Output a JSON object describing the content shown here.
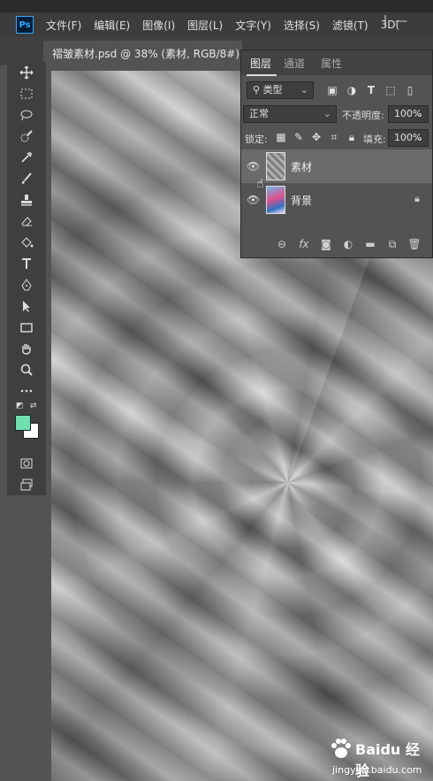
{
  "app": {
    "logo": "Ps"
  },
  "menu": [
    "文件(F)",
    "编辑(E)",
    "图像(I)",
    "图层(L)",
    "文字(Y)",
    "选择(S)",
    "滤镜(T)",
    "3D("
  ],
  "document_tab": {
    "title": "褶皱素材.psd @ 38% (素材, RGB/8#)",
    "close": "×"
  },
  "tools": [
    "move-icon",
    "marquee-icon",
    "lasso-icon",
    "quick-select-icon",
    "eyedropper-icon",
    "brush-icon",
    "stamp-icon",
    "eraser-icon",
    "paint-bucket-icon",
    "type-icon",
    "pen-icon",
    "path-select-icon",
    "rectangle-icon",
    "hand-icon",
    "zoom-icon",
    "more-icon"
  ],
  "colors": {
    "foreground": "#6ee0b0",
    "background": "#ffffff"
  },
  "layers_panel": {
    "tabs": [
      "图层",
      "通道",
      "属性"
    ],
    "filter_kind": "类型",
    "blend_mode": "正常",
    "opacity_label": "不透明度:",
    "opacity_value": "100%",
    "lock_label": "锁定:",
    "fill_label": "填充:",
    "fill_value": "100%",
    "layers": [
      {
        "name": "素材",
        "selected": true,
        "locked": false
      },
      {
        "name": "背景",
        "selected": false,
        "locked": true
      }
    ]
  },
  "watermark": {
    "main": "Baidu 经验",
    "url": "jingyan.baidu.com"
  }
}
